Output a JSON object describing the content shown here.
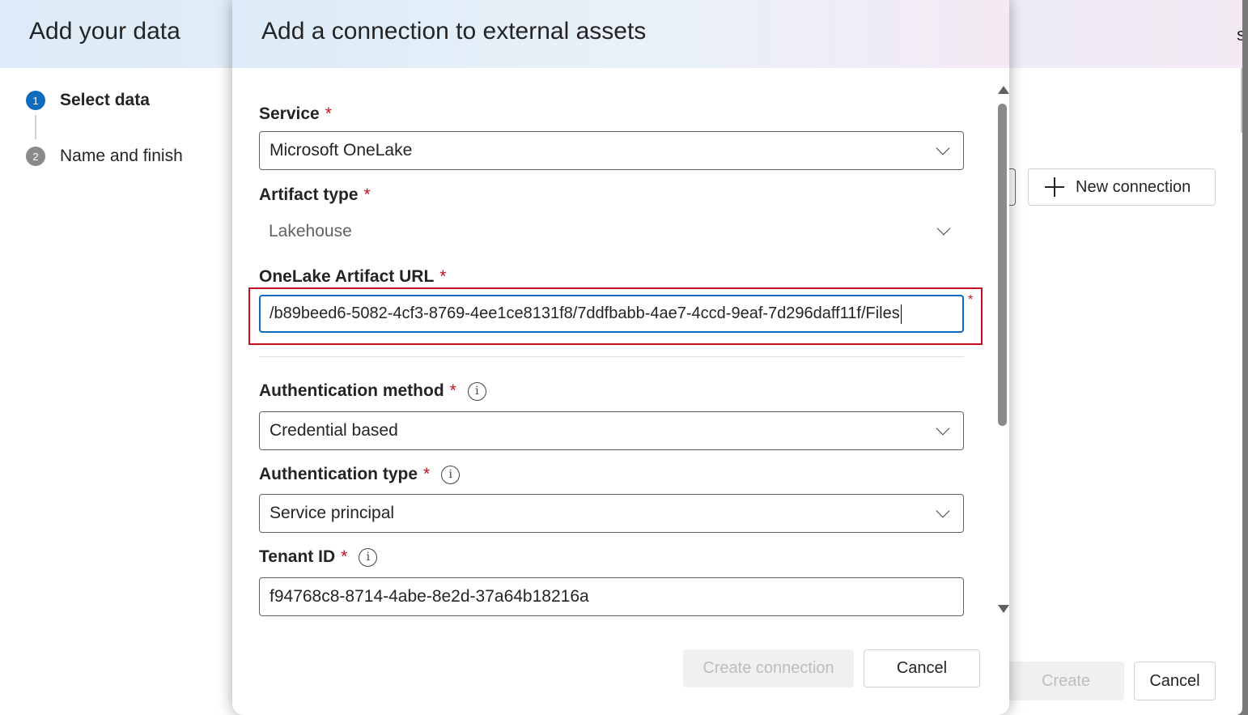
{
  "wizard": {
    "title": "Add your data",
    "title_edge": "se",
    "steps": [
      {
        "number": "1",
        "label": "Select data",
        "state": "active"
      },
      {
        "number": "2",
        "label": "Name and finish",
        "state": "inactive"
      }
    ],
    "new_connection_label": "New connection",
    "create_label": "Create",
    "cancel_label": "Cancel"
  },
  "dialog": {
    "title": "Add a connection to external assets",
    "required_mark": "*",
    "info_glyph": "i",
    "service": {
      "label": "Service",
      "value": "Microsoft OneLake"
    },
    "artifact_type": {
      "label": "Artifact type",
      "value": "Lakehouse"
    },
    "artifact_url": {
      "label": "OneLake Artifact URL",
      "value": "/b89beed6-5082-4cf3-8769-4ee1ce8131f8/7ddfbabb-4ae7-4ccd-9eaf-7d296daff11f/Files"
    },
    "auth_method": {
      "label": "Authentication method",
      "value": "Credential based"
    },
    "auth_type": {
      "label": "Authentication type",
      "value": "Service principal"
    },
    "tenant_id": {
      "label": "Tenant ID",
      "value": "f94768c8-8714-4abe-8e2d-37a64b18216a"
    },
    "create_connection_label": "Create connection",
    "cancel_label": "Cancel"
  },
  "colors": {
    "accent": "#0f6cbd",
    "required": "#c50f1f",
    "highlight_box": "#c50f1f"
  },
  "icons": [
    "plus-icon",
    "chevron-down-icon",
    "info-icon",
    "scroll-up-arrow-icon",
    "scroll-down-arrow-icon"
  ]
}
